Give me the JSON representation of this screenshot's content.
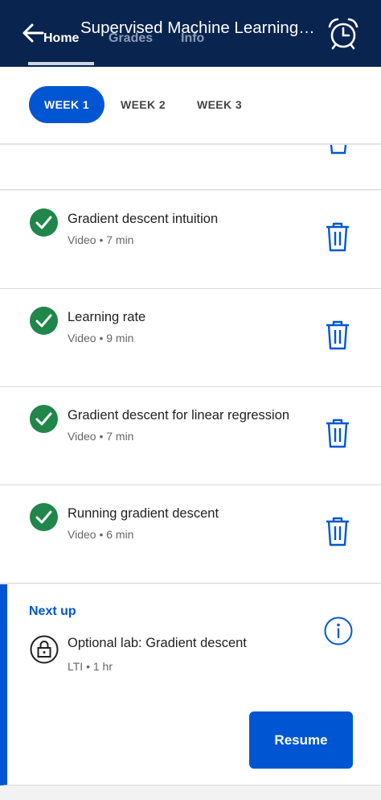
{
  "header": {
    "title": "Supervised Machine Learning: Regression and Classification",
    "tabs": [
      {
        "label": "Home"
      },
      {
        "label": "Grades"
      },
      {
        "label": "Info"
      }
    ]
  },
  "weeks": [
    {
      "label": "WEEK 1"
    },
    {
      "label": "WEEK 2"
    },
    {
      "label": "WEEK 3"
    }
  ],
  "items": [
    {
      "title": "Gradient descent intuition",
      "meta": "Video • 7 min"
    },
    {
      "title": "Learning rate",
      "meta": "Video • 9 min"
    },
    {
      "title": "Gradient descent for linear regression",
      "meta": "Video • 7 min"
    },
    {
      "title": "Running gradient descent",
      "meta": "Video • 6 min"
    }
  ],
  "next_up": {
    "label": "Next up",
    "title": "Optional lab: Gradient descent",
    "meta": "LTI • 1 hr",
    "button": "Resume"
  },
  "colors": {
    "header_bg": "#0a2450",
    "accent": "#0056d2",
    "complete": "#20864a"
  }
}
